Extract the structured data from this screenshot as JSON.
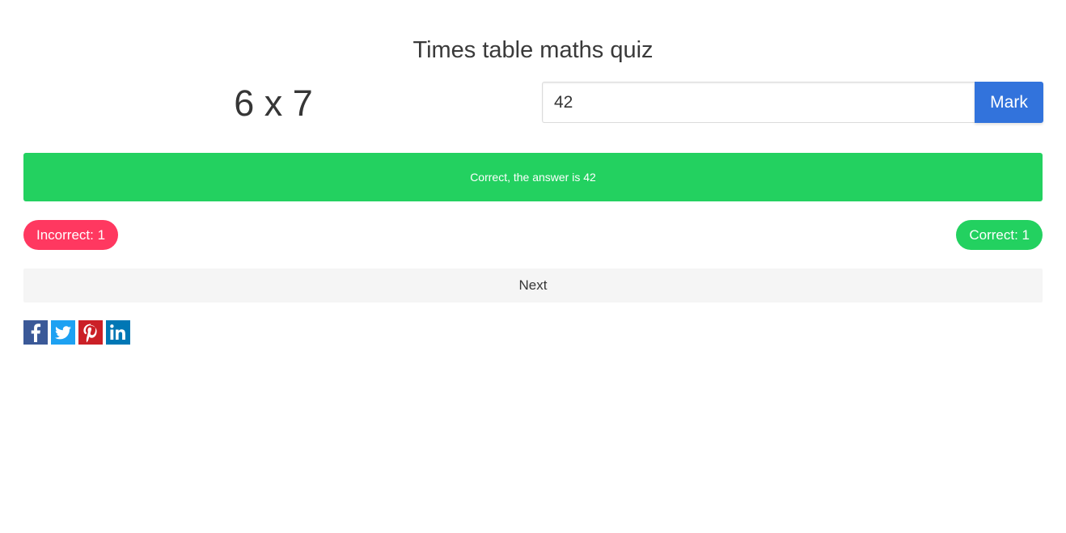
{
  "quiz": {
    "title": "Times table maths quiz",
    "question": "6 x 7",
    "answer_value": "42",
    "mark_label": "Mark",
    "feedback": "Correct, the answer is 42",
    "incorrect_label": "Incorrect: 1",
    "correct_label": "Correct: 1",
    "next_label": "Next"
  },
  "share": [
    {
      "name": "facebook",
      "icon": "facebook-icon",
      "color": "#3b5998"
    },
    {
      "name": "twitter",
      "icon": "twitter-icon",
      "color": "#1da1f2"
    },
    {
      "name": "pinterest",
      "icon": "pinterest-icon",
      "color": "#cb2027"
    },
    {
      "name": "linkedin",
      "icon": "linkedin-icon",
      "color": "#0077b5"
    }
  ],
  "colors": {
    "primary": "#3273dc",
    "success": "#23d160",
    "danger": "#ff3860",
    "light": "#f5f5f5"
  }
}
